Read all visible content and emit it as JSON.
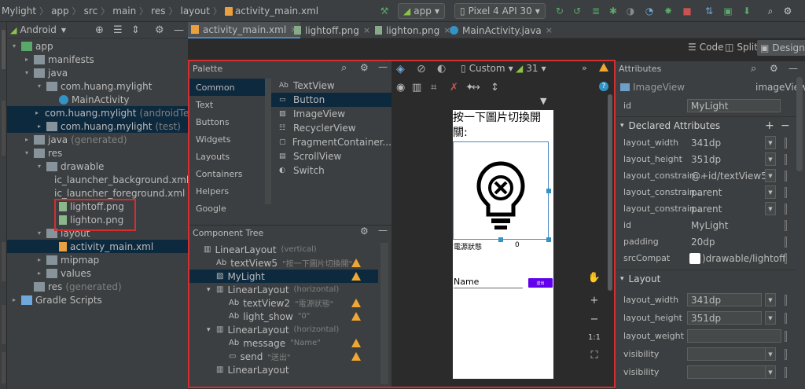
{
  "nav": {
    "breadcrumbs": [
      "Mylight",
      "app",
      "src",
      "main",
      "res",
      "layout",
      "activity_main.xml"
    ],
    "run_config": "app",
    "device": "Pixel 4 API 30"
  },
  "project_panel": {
    "view": "Android",
    "tree": [
      {
        "label": "app",
        "depth": 0,
        "arrow": "▾",
        "icon": "module-icon"
      },
      {
        "label": "manifests",
        "depth": 1,
        "arrow": "▸",
        "icon": "folder-icon"
      },
      {
        "label": "java",
        "depth": 1,
        "arrow": "▾",
        "icon": "folder-icon"
      },
      {
        "label": "com.huang.mylight",
        "depth": 2,
        "arrow": "▾",
        "icon": "package-icon"
      },
      {
        "label": "MainActivity",
        "depth": 3,
        "arrow": "",
        "icon": "class-icon"
      },
      {
        "label": "com.huang.mylight",
        "suffix": "(androidTes",
        "depth": 2,
        "arrow": "▸",
        "icon": "package-icon",
        "selected": true
      },
      {
        "label": "com.huang.mylight",
        "suffix": "(test)",
        "depth": 2,
        "arrow": "▸",
        "icon": "package-icon",
        "selected": true
      },
      {
        "label": "java",
        "suffix": "(generated)",
        "depth": 1,
        "arrow": "▸",
        "icon": "folder-icon"
      },
      {
        "label": "res",
        "depth": 1,
        "arrow": "▾",
        "icon": "folder-icon"
      },
      {
        "label": "drawable",
        "depth": 2,
        "arrow": "▾",
        "icon": "folder-icon"
      },
      {
        "label": "ic_launcher_background.xml",
        "depth": 3,
        "arrow": "",
        "icon": "xml-file-icon"
      },
      {
        "label": "ic_launcher_foreground.xml",
        "suffix": "(",
        "depth": 3,
        "arrow": "",
        "icon": "xml-file-icon"
      },
      {
        "label": "lightoff.png",
        "depth": 3,
        "arrow": "",
        "icon": "image-file-icon"
      },
      {
        "label": "lighton.png",
        "depth": 3,
        "arrow": "",
        "icon": "image-file-icon"
      },
      {
        "label": "layout",
        "depth": 2,
        "arrow": "▾",
        "icon": "folder-icon"
      },
      {
        "label": "activity_main.xml",
        "depth": 3,
        "arrow": "",
        "icon": "xml-file-icon",
        "selected": true
      },
      {
        "label": "mipmap",
        "depth": 2,
        "arrow": "▸",
        "icon": "folder-icon"
      },
      {
        "label": "values",
        "depth": 2,
        "arrow": "▸",
        "icon": "folder-icon"
      },
      {
        "label": "res",
        "suffix": "(generated)",
        "depth": 1,
        "arrow": "",
        "icon": "folder-icon"
      },
      {
        "label": "Gradle Scripts",
        "depth": 0,
        "arrow": "▸",
        "icon": "gradle-icon"
      }
    ]
  },
  "tabs": [
    {
      "label": "activity_main.xml",
      "active": true
    },
    {
      "label": "lightoff.png"
    },
    {
      "label": "lighton.png"
    },
    {
      "label": "MainActivity.java"
    }
  ],
  "view_modes": {
    "code": "Code",
    "split": "Split",
    "design": "Design"
  },
  "palette": {
    "title": "Palette",
    "categories": [
      "Common",
      "Text",
      "Buttons",
      "Widgets",
      "Layouts",
      "Containers",
      "Helpers",
      "Google"
    ],
    "items": [
      {
        "label": "TextView",
        "icon": "Ab"
      },
      {
        "label": "Button",
        "icon": "btn"
      },
      {
        "label": "ImageView",
        "icon": "img"
      },
      {
        "label": "RecyclerView",
        "icon": "rv"
      },
      {
        "label": "FragmentContainer...",
        "icon": "frag"
      },
      {
        "label": "ScrollView",
        "icon": "sv"
      },
      {
        "label": "Switch",
        "icon": "sw"
      }
    ]
  },
  "design_toolbar": {
    "theme": "Custom",
    "api": "31"
  },
  "component_tree": {
    "title": "Component Tree",
    "rows": [
      {
        "label": "LinearLayout",
        "sub": "(vertical)",
        "depth": 0,
        "arrow": "",
        "warn": false
      },
      {
        "label": "textView5",
        "sub": "\"按一下圖片切換開\"",
        "depth": 1,
        "arrow": "",
        "warn": true,
        "icon": "Ab"
      },
      {
        "label": "MyLight",
        "sub": "",
        "depth": 1,
        "arrow": "",
        "warn": true,
        "icon": "img",
        "selected": true
      },
      {
        "label": "LinearLayout",
        "sub": "(horizontal)",
        "depth": 1,
        "arrow": "▾",
        "warn": false,
        "icon": "ll"
      },
      {
        "label": "textView2",
        "sub": "\"電源狀態\"",
        "depth": 2,
        "arrow": "",
        "warn": true,
        "icon": "Ab"
      },
      {
        "label": "light_show",
        "sub": "\"0\"",
        "depth": 2,
        "arrow": "",
        "warn": true,
        "icon": "Ab"
      },
      {
        "label": "LinearLayout",
        "sub": "(horizontal)",
        "depth": 1,
        "arrow": "▾",
        "warn": false,
        "icon": "ll"
      },
      {
        "label": "message",
        "sub": "\"Name\"",
        "depth": 2,
        "arrow": "",
        "warn": true,
        "icon": "Ab_"
      },
      {
        "label": "send",
        "sub": "\"送出\"",
        "depth": 2,
        "arrow": "",
        "warn": true,
        "icon": "btn"
      },
      {
        "label": "LinearLayout",
        "sub": "",
        "depth": 1,
        "arrow": "",
        "warn": false,
        "icon": ""
      }
    ]
  },
  "phone_preview": {
    "title_text": "按一下圖片切換開關:",
    "power_label": "電源狀態",
    "power_value": "0",
    "name_hint": "Name",
    "send_label": "送出"
  },
  "attributes": {
    "title": "Attributes",
    "widget_type": "ImageView",
    "widget_class": "imageView",
    "id_label": "id",
    "id_value": "MyLight",
    "declared_title": "Declared Attributes",
    "declared": [
      {
        "key": "layout_width",
        "value": "341dp",
        "dropdown": true
      },
      {
        "key": "layout_height",
        "value": "351dp",
        "dropdown": true
      },
      {
        "key": "layout_constrain...",
        "value": "@+id/textView5",
        "dropdown": true
      },
      {
        "key": "layout_constrain...",
        "value": "parent",
        "dropdown": true
      },
      {
        "key": "layout_constrain...",
        "value": "parent",
        "dropdown": true
      },
      {
        "key": "id",
        "value": "MyLight",
        "dropdown": false
      },
      {
        "key": "padding",
        "value": "20dp",
        "dropdown": false
      },
      {
        "key": "srcCompat",
        "value": ")drawable/lightoff",
        "dropdown": false
      }
    ],
    "layout_title": "Layout",
    "layout": [
      {
        "key": "layout_width",
        "value": "341dp"
      },
      {
        "key": "layout_height",
        "value": "351dp"
      },
      {
        "key": "layout_weight",
        "value": ""
      },
      {
        "key": "visibility",
        "value": ""
      },
      {
        "key": "visibility",
        "value": ""
      }
    ]
  },
  "colors": {
    "accent": "#6200ee",
    "highlight": "#d32f2f",
    "selection": "#0d293e"
  }
}
